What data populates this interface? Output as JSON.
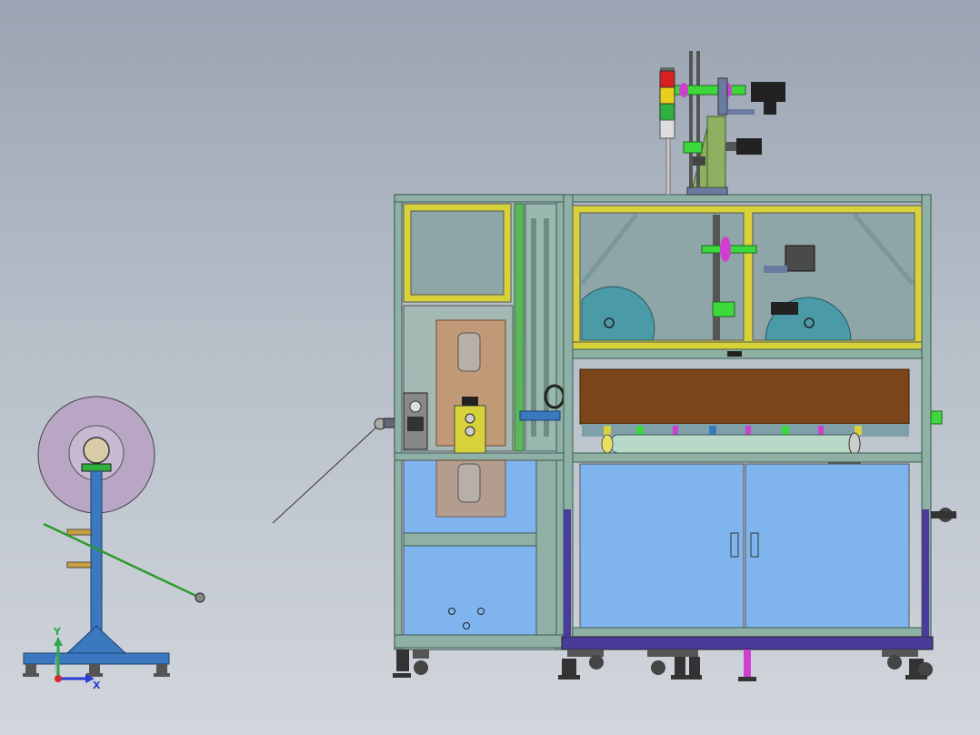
{
  "viewport": {
    "background_top": "#9aa4b2",
    "background_bottom": "#d2d6dc"
  },
  "triad": {
    "y_label": "Y",
    "x_label": "X",
    "y_color": "#2ea84a",
    "x_color": "#2a3cd6",
    "z_color": "#d42a2a"
  },
  "colors": {
    "frame": "#8fb0a4",
    "frame_dark": "#3c5a55",
    "yellow_panel": "#d8d23a",
    "glass": "#8fa6a8",
    "lower_panel_blue": "#7fb4ee",
    "brown_panel": "#7a4518",
    "reel_teal": "#4a9aa8",
    "reel_purple": "#b9a6c4",
    "stand_blue": "#3a78c0",
    "signal_red": "#d82020",
    "signal_yellow": "#e8d020",
    "signal_green": "#30b040",
    "motor_black": "#222222",
    "green_part": "#3cd83c",
    "magenta_part": "#d040d0"
  }
}
